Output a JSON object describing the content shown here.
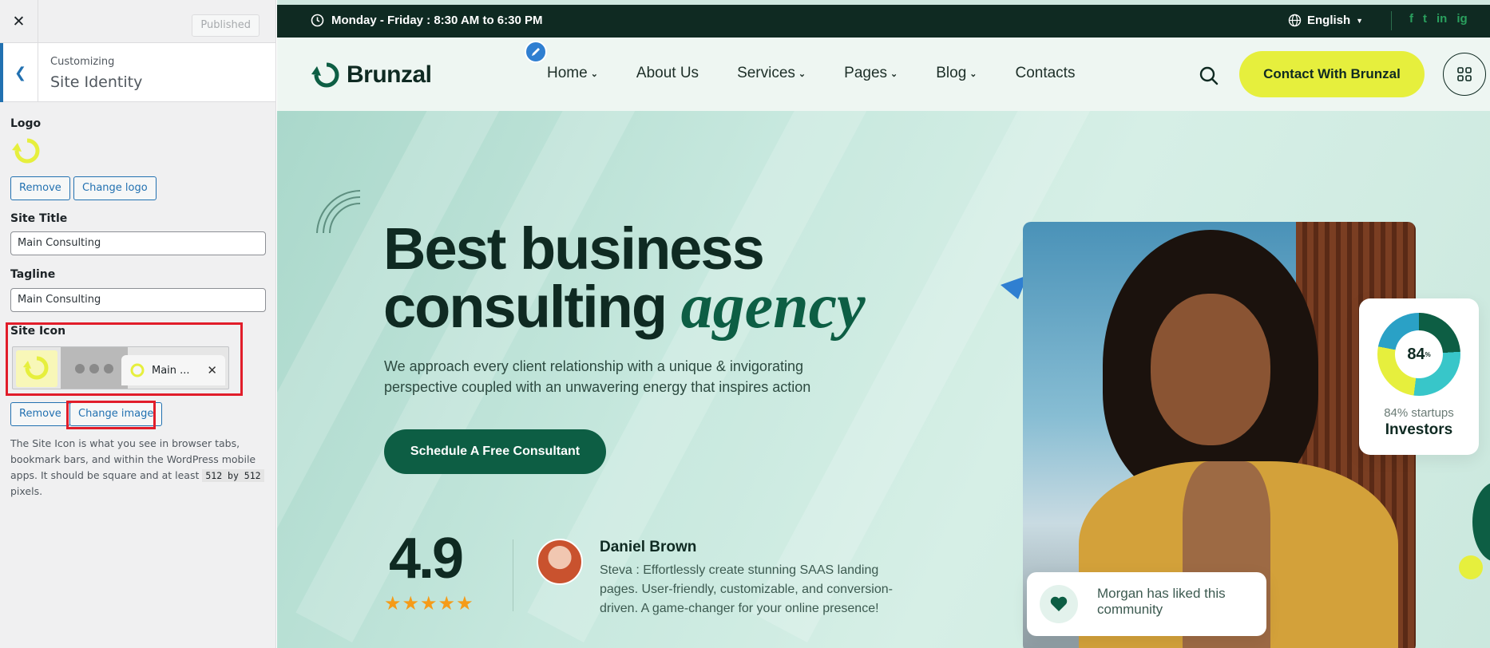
{
  "sidebar": {
    "close_icon": "close-icon",
    "published_label": "Published",
    "back_icon": "chevron-left-icon",
    "breadcrumb_small": "Customizing",
    "breadcrumb_title": "Site Identity",
    "logo_label": "Logo",
    "logo_remove": "Remove",
    "logo_change": "Change logo",
    "site_title_label": "Site Title",
    "site_title_value": "Main Consulting",
    "tagline_label": "Tagline",
    "tagline_value": "Main Consulting",
    "site_icon_label": "Site Icon",
    "site_icon_tab_text": "Main ...",
    "icon_remove": "Remove",
    "icon_change": "Change image",
    "desc_before": "The Site Icon is what you see in browser tabs, bookmark bars, and within the WordPress mobile apps. It should be square and at least",
    "desc_code": "512 by 512",
    "desc_after": "pixels.",
    "accent_color": "#2271b1",
    "highlight_color": "#e11d2a"
  },
  "topbar": {
    "hours": "Monday - Friday : 8:30 AM to 6:30 PM",
    "language": "English",
    "socials": [
      "f",
      "t",
      "in",
      "ig"
    ]
  },
  "navbar": {
    "brand": "Brunzal",
    "menu": [
      {
        "label": "Home",
        "has_dropdown": true
      },
      {
        "label": "About Us",
        "has_dropdown": false
      },
      {
        "label": "Services",
        "has_dropdown": true
      },
      {
        "label": "Pages",
        "has_dropdown": true
      },
      {
        "label": "Blog",
        "has_dropdown": true
      },
      {
        "label": "Contacts",
        "has_dropdown": false
      }
    ],
    "contact_button": "Contact With Brunzal"
  },
  "hero": {
    "title_line1": "Best business",
    "title_line2": "consulting",
    "title_accent": "agency",
    "subtitle": "We approach every client relationship with a unique & invigorating perspective coupled with an unwavering energy that inspires action",
    "cta": "Schedule A Free Consultant",
    "rating": "4.9",
    "stars": "★★★★★",
    "reviewer_name": "Daniel Brown",
    "review_text": "Steva : Effortlessly create stunning SAAS landing pages. User-friendly, customizable, and conversion-driven. A game-changer for your online presence!",
    "stat_percent": "84",
    "stat_percent_suffix": "%",
    "stat_caption": "84% startups",
    "stat_title": "Investors",
    "community_text": "Morgan has liked this community"
  },
  "colors": {
    "dark_green": "#0f2a22",
    "brand_green": "#0d5e44",
    "lime": "#e6ef3d",
    "star_orange": "#f59b18"
  }
}
